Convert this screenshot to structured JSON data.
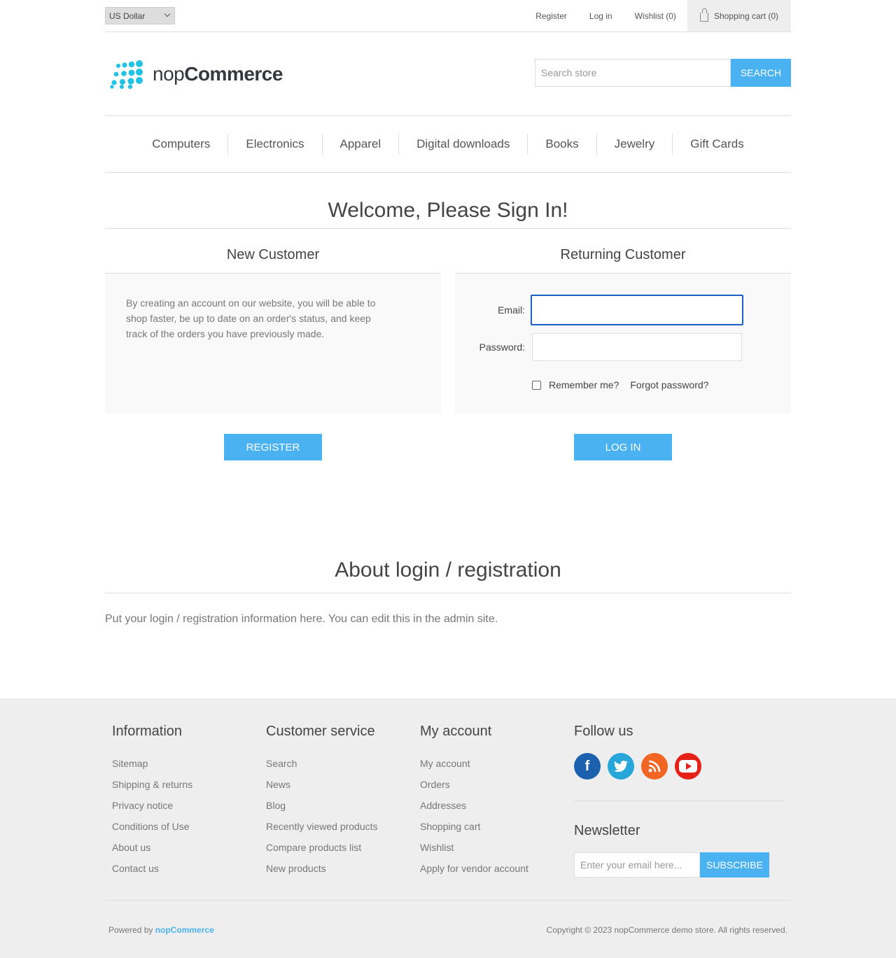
{
  "header": {
    "currency": "US Dollar",
    "links": {
      "register": "Register",
      "login": "Log in",
      "wishlist": "Wishlist (0)",
      "cart": "Shopping cart (0)"
    },
    "logo": {
      "part1": "nop",
      "part2": "Commerce"
    },
    "search": {
      "placeholder": "Search store",
      "button": "Search"
    }
  },
  "menu": [
    "Computers",
    "Electronics",
    "Apparel",
    "Digital downloads",
    "Books",
    "Jewelry",
    "Gift Cards"
  ],
  "page": {
    "title": "Welcome, Please Sign In!",
    "new_customer": {
      "title": "New Customer",
      "text": "By creating an account on our website, you will be able to shop faster, be up to date on an order's status, and keep track of the orders you have previously made.",
      "button": "Register"
    },
    "returning_customer": {
      "title": "Returning Customer",
      "email_label": "Email:",
      "email_value": "",
      "password_label": "Password:",
      "password_value": "",
      "remember_label": "Remember me?",
      "remember_checked": false,
      "forgot": "Forgot password?",
      "button": "Log in"
    },
    "about": {
      "title": "About login / registration",
      "text": "Put your login / registration information here. You can edit this in the admin site."
    }
  },
  "footer": {
    "information": {
      "title": "Information",
      "links": [
        "Sitemap",
        "Shipping & returns",
        "Privacy notice",
        "Conditions of Use",
        "About us",
        "Contact us"
      ]
    },
    "customer_service": {
      "title": "Customer service",
      "links": [
        "Search",
        "News",
        "Blog",
        "Recently viewed products",
        "Compare products list",
        "New products"
      ]
    },
    "my_account": {
      "title": "My account",
      "links": [
        "My account",
        "Orders",
        "Addresses",
        "Shopping cart",
        "Wishlist",
        "Apply for vendor account"
      ]
    },
    "follow": {
      "title": "Follow us",
      "icons": [
        "facebook-icon",
        "twitter-icon",
        "rss-icon",
        "youtube-icon"
      ]
    },
    "newsletter": {
      "title": "Newsletter",
      "placeholder": "Enter your email here...",
      "button": "Subscribe"
    },
    "powered_prefix": "Powered by",
    "powered_brand": "nopCommerce",
    "copyright": "Copyright © 2023 nopCommerce demo store. All rights reserved."
  },
  "colors": {
    "accent": "#4ab2f1",
    "focus_border": "#1a5fc4",
    "footer_bg": "#eeeeee"
  }
}
